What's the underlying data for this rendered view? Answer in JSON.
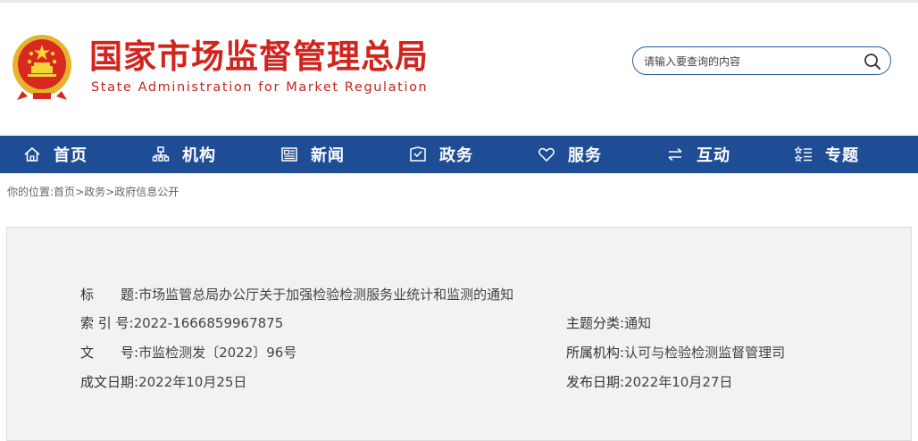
{
  "header": {
    "logo_cn": "国家市场监督管理总局",
    "logo_en": "State Administration for Market Regulation",
    "emblem_icon": "national-emblem-icon"
  },
  "search": {
    "placeholder": "请输入要查询的内容",
    "icon": "search-icon"
  },
  "nav": {
    "items": [
      {
        "label": "首页",
        "icon": "home-icon"
      },
      {
        "label": "机构",
        "icon": "org-chart-icon"
      },
      {
        "label": "新闻",
        "icon": "newspaper-icon"
      },
      {
        "label": "政务",
        "icon": "shield-check-icon"
      },
      {
        "label": "服务",
        "icon": "heart-icon"
      },
      {
        "label": "互动",
        "icon": "exchange-arrows-icon"
      },
      {
        "label": "专题",
        "icon": "topic-list-icon"
      }
    ],
    "colors": {
      "background": "#1e4d96",
      "text": "#ffffff"
    }
  },
  "breadcrumb": {
    "prefix": "你的位置:",
    "items": [
      "首页",
      "政务",
      "政府信息公开"
    ],
    "separator": ">"
  },
  "doc": {
    "title_label": "标　　题:",
    "title_value": "市场监管总局办公厅关于加强检验检测服务业统计和监测的通知",
    "index_label": "索 引 号:",
    "index_value": "2022-1666859967875",
    "topic_label": "主题分类:",
    "topic_value": "通知",
    "docno_label": "文　　号:",
    "docno_value": "市监检测发〔2022〕96号",
    "org_label": "所属机构:",
    "org_value": "认可与检验检测监督管理司",
    "date_label": "成文日期:",
    "date_value": "2022年10月25日",
    "pub_label": "发布日期:",
    "pub_value": "2022年10月27日"
  },
  "colors": {
    "brand_red": "#d2231d",
    "brand_blue": "#1e4d96",
    "panel_bg": "#f2f2f2"
  }
}
